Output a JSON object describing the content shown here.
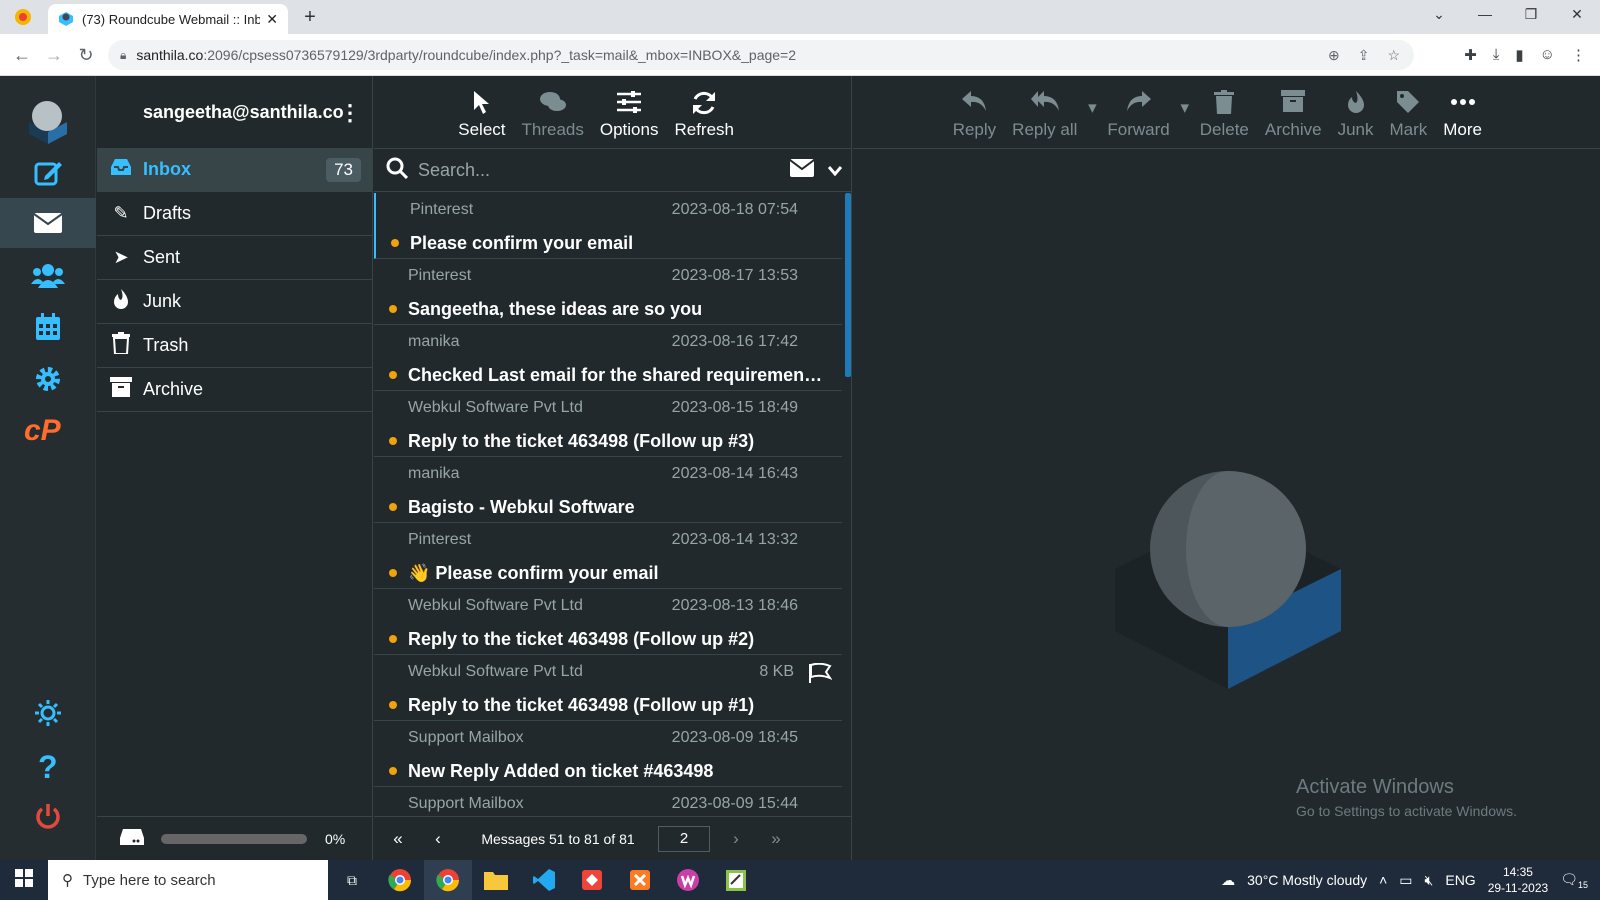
{
  "browser": {
    "tab_title": "(73) Roundcube Webmail :: Inbo",
    "url_host": "santhila.co",
    "url_rest": ":2096/cpsess0736579129/3rdparty/roundcube/index.php?_task=mail&_mbox=INBOX&_page=2"
  },
  "account": {
    "email": "sangeetha@santhila.co"
  },
  "folders": [
    {
      "name": "Inbox",
      "count": "73",
      "icon": "inbox-icon"
    },
    {
      "name": "Drafts",
      "icon": "pencil-icon"
    },
    {
      "name": "Sent",
      "icon": "paper-plane-icon"
    },
    {
      "name": "Junk",
      "icon": "fire-icon"
    },
    {
      "name": "Trash",
      "icon": "trash-icon"
    },
    {
      "name": "Archive",
      "icon": "archive-box-icon"
    }
  ],
  "quota": {
    "percent": "0%"
  },
  "list_toolbar": {
    "select": "Select",
    "threads": "Threads",
    "options": "Options",
    "refresh": "Refresh"
  },
  "search": {
    "placeholder": "Search..."
  },
  "messages": [
    {
      "from": "Pinterest",
      "date": "2023-08-18 07:54",
      "subject": "Please confirm your email"
    },
    {
      "from": "Pinterest",
      "date": "2023-08-17 13:53",
      "subject": "Sangeetha, these ideas are so you"
    },
    {
      "from": "manika",
      "date": "2023-08-16 17:42",
      "subject": "Checked Last email for the shared requirement -..."
    },
    {
      "from": "Webkul Software Pvt Ltd",
      "date": "2023-08-15 18:49",
      "subject": "Reply to the ticket 463498 (Follow up #3)"
    },
    {
      "from": "manika",
      "date": "2023-08-14 16:43",
      "subject": "Bagisto - Webkul Software"
    },
    {
      "from": "Pinterest",
      "date": "2023-08-14 13:32",
      "subject": "👋 Please confirm your email"
    },
    {
      "from": "Webkul Software Pvt Ltd",
      "date": "2023-08-13 18:46",
      "subject": "Reply to the ticket 463498 (Follow up #2)"
    },
    {
      "from": "Webkul Software Pvt Ltd",
      "date": "8 KB",
      "subject": "Reply to the ticket 463498 (Follow up #1)"
    },
    {
      "from": "Support Mailbox",
      "date": "2023-08-09 18:45",
      "subject": "New Reply Added on ticket #463498"
    },
    {
      "from": "Support Mailbox",
      "date": "2023-08-09 15:44",
      "subject": ""
    }
  ],
  "pager": {
    "text": "Messages 51 to 81 of 81",
    "page": "2"
  },
  "message_toolbar": {
    "reply": "Reply",
    "reply_all": "Reply all",
    "forward": "Forward",
    "delete": "Delete",
    "archive": "Archive",
    "junk": "Junk",
    "mark": "Mark",
    "more": "More"
  },
  "watermark": {
    "title": "Activate Windows",
    "sub": "Go to Settings to activate Windows."
  },
  "taskbar": {
    "search_placeholder": "Type here to search",
    "weather": "30°C  Mostly cloudy",
    "lang": "ENG",
    "time": "14:35",
    "date": "29-11-2023",
    "notif_count": "15"
  },
  "colors": {
    "accent": "#37beff",
    "unread_dot": "#f0a30a",
    "cpanel": "#ff6c2c"
  }
}
